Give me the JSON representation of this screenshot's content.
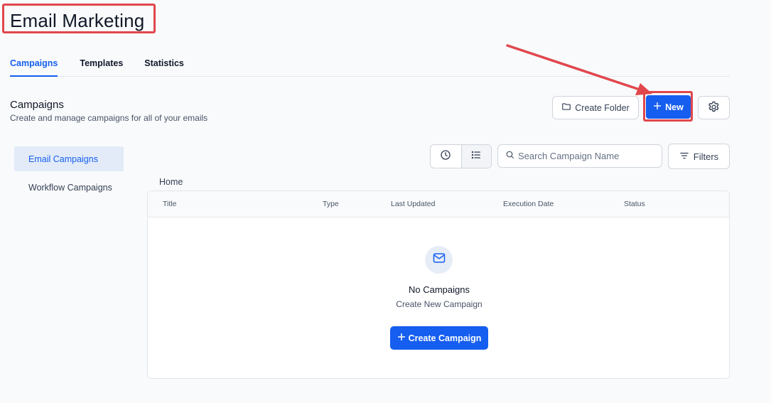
{
  "page": {
    "title": "Email Marketing"
  },
  "tabs": [
    {
      "label": "Campaigns",
      "active": true
    },
    {
      "label": "Templates",
      "active": false
    },
    {
      "label": "Statistics",
      "active": false
    }
  ],
  "section": {
    "title": "Campaigns",
    "subtitle": "Create and manage campaigns for all of your emails"
  },
  "toolbar": {
    "create_folder_label": "Create Folder",
    "new_label": "New",
    "settings_icon": "gear-icon"
  },
  "sidebar": {
    "items": [
      {
        "label": "Email Campaigns",
        "active": true
      },
      {
        "label": "Workflow Campaigns",
        "active": false
      }
    ]
  },
  "controls": {
    "search_placeholder": "Search Campaign Name",
    "filters_label": "Filters",
    "view_modes": [
      "clock-icon",
      "list-icon"
    ]
  },
  "breadcrumb": "Home",
  "table": {
    "columns": [
      "Title",
      "Type",
      "Last Updated",
      "Execution Date",
      "Status"
    ],
    "rows": []
  },
  "empty_state": {
    "icon": "mail-icon",
    "title": "No Campaigns",
    "subtitle": "Create New Campaign",
    "button_label": "Create Campaign"
  },
  "colors": {
    "primary": "#155eef",
    "annotation": "#e0474c",
    "active_nav_bg": "#e3ebf9"
  }
}
